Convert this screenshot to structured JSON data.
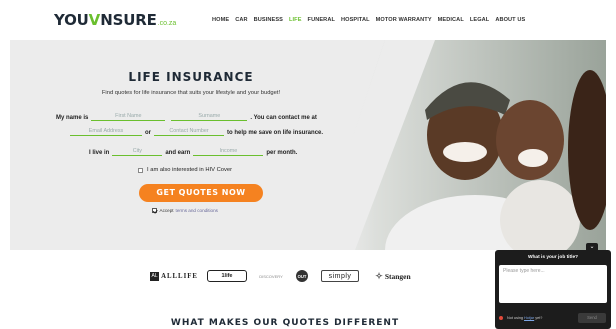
{
  "header": {
    "logo_main": "YOU",
    "logo_v": "V",
    "logo_rest": "NSURE",
    "logo_tld": ".co.za",
    "nav": [
      {
        "label": "HOME",
        "active": false
      },
      {
        "label": "CAR",
        "active": false
      },
      {
        "label": "BUSINESS",
        "active": false
      },
      {
        "label": "LIFE",
        "active": true
      },
      {
        "label": "FUNERAL",
        "active": false
      },
      {
        "label": "HOSPITAL",
        "active": false
      },
      {
        "label": "MOTOR WARRANTY",
        "active": false
      },
      {
        "label": "MEDICAL",
        "active": false
      },
      {
        "label": "LEGAL",
        "active": false
      },
      {
        "label": "ABOUT US",
        "active": false
      }
    ]
  },
  "hero": {
    "title": "LIFE INSURANCE",
    "subtitle": "Find quotes for life insurance that suits your lifestyle and your budget!",
    "form": {
      "my_name_is": "My name is",
      "first_name_placeholder": "First Name",
      "surname_placeholder": "Surname",
      "contact_text": ". You can contact me at",
      "email_placeholder": "Email Address",
      "or_text": "or",
      "contact_number_placeholder": "Contact Number",
      "help_text": "to help me save on life insurance.",
      "i_live_in": "I live in",
      "city_placeholder": "City",
      "and_earn": "and earn",
      "income_placeholder": "Income",
      "per_month": "per month.",
      "hiv_label": "I am also interested in HIV Cover",
      "cta_label": "GET QUOTES NOW",
      "accept_label": "Accept",
      "terms_label": "terms and conditions"
    }
  },
  "partners": {
    "alllife_box": "AL",
    "alllife": "ALLLIFE",
    "onelife": "1life",
    "discovery": "DISCOVERY",
    "out": "OUT",
    "simply": "simply",
    "stangen": "Stangen"
  },
  "section_heading": "WHAT MAKES OUR QUOTES DIFFERENT",
  "widget": {
    "title": "What is your job title?",
    "placeholder": "Please type here...",
    "footer_prefix": "Not using",
    "footer_link": "Hotjar",
    "footer_suffix": "yet?",
    "submit_label": "Send",
    "close_glyph": "⌄"
  },
  "colors": {
    "brand_green": "#6abf2e",
    "cta_orange": "#f58220",
    "dark_navy": "#1f2a36",
    "widget_bg": "#1c1c1c"
  },
  "icons": [
    "checkbox-icon",
    "checkmark-icon",
    "star-icon",
    "hotjar-dot-icon",
    "chevron-down-icon"
  ]
}
